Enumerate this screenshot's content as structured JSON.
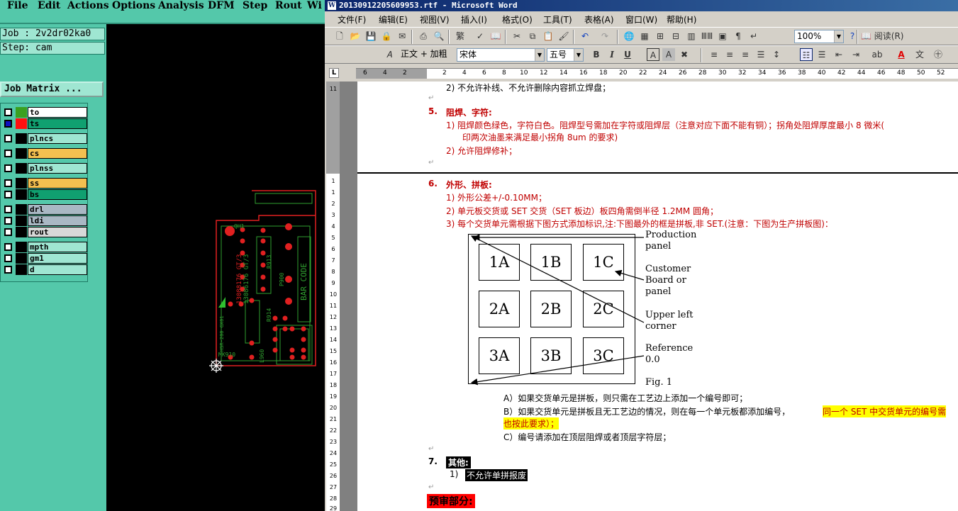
{
  "cam": {
    "menu": [
      "File",
      "Edit",
      "Actions",
      "Options",
      "Analysis",
      "DFM",
      "Step",
      "Rout",
      "Wi"
    ],
    "job_label": "Job : 2v2dr02ka0",
    "step_label": "Step: cam",
    "job_matrix_button": "Job Matrix ...",
    "layers": [
      {
        "name": "to",
        "color": "#ffffff",
        "swatch2": "#3aa020",
        "checked": false
      },
      {
        "name": "ts",
        "color": "#10a070",
        "swatch2": "#ff1010",
        "checked": true
      },
      {
        "name": "plncs",
        "color": "#9fe6d2",
        "checked": false
      },
      {
        "name": "cs",
        "color": "#f4c050",
        "checked": false
      },
      {
        "name": "plnss",
        "color": "#9fe6d2",
        "checked": false
      },
      {
        "name": "ss",
        "color": "#f4c050",
        "checked": false
      },
      {
        "name": "bs",
        "color": "#10a070",
        "checked": false
      },
      {
        "name": "drl",
        "color": "#a9b8c4",
        "checked": false
      },
      {
        "name": "ldi",
        "color": "#a9b8c4",
        "checked": false
      },
      {
        "name": "rout",
        "color": "#d8d8d8",
        "checked": false
      },
      {
        "name": "mpth",
        "color": "#9fe6d2",
        "checked": false
      },
      {
        "name": "gm1",
        "color": "#9fe6d2",
        "checked": false
      },
      {
        "name": "d",
        "color": "#9fe6d2",
        "checked": false
      }
    ],
    "board_text": {
      "refs": [
        "QH1",
        "R913",
        "R914",
        "MK910",
        "L960",
        "P900"
      ],
      "vertical": [
        "13088176 GT/3",
        "13086176 GT/3",
        "BAR CODE",
        "HSR-200 GX01"
      ]
    }
  },
  "word": {
    "title": "20130912205609953.rtf - Microsoft Word",
    "menu": [
      "文件(F)",
      "编辑(E)",
      "视图(V)",
      "插入(I)",
      "格式(O)",
      "工具(T)",
      "表格(A)",
      "窗口(W)",
      "帮助(H)"
    ],
    "zoom": "100%",
    "read_button": "阅读(R)",
    "style_combo": "正文 + 加粗",
    "font_combo": "宋体",
    "size_combo": "五号",
    "ruler_numbers": [
      "6",
      "4",
      "2",
      "2",
      "4",
      "6",
      "8",
      "10",
      "12",
      "14",
      "16",
      "18",
      "20",
      "22",
      "24",
      "26",
      "28",
      "30",
      "32",
      "34",
      "36",
      "38",
      "40",
      "42",
      "44",
      "46",
      "48",
      "50",
      "52"
    ],
    "vruler_numbers": [
      "11",
      "1",
      "1",
      "2",
      "3",
      "4",
      "5",
      "6",
      "7",
      "8",
      "9",
      "10",
      "11",
      "12",
      "13",
      "14",
      "15",
      "16",
      "17",
      "18",
      "19",
      "20",
      "21",
      "22",
      "23",
      "24",
      "25",
      "26",
      "27",
      "28",
      "29"
    ],
    "doc": {
      "top_item": "2)  不允许补线、不允许删除内容抓立焊盘；",
      "s5_num": "5.",
      "s5_title": "阻焊、字符:",
      "s5_item1a": "1)  阻焊颜色绿色，字符白色。阻焊型号需加在字符或阻焊层（注意对应下面不能有铜）；拐角处阻焊厚度最小 8 微米(",
      "s5_item1b": "印两次油墨来满足最小拐角 8um 的要求)",
      "s5_item2": "2)  允许阻焊修补；",
      "s6_num": "6.",
      "s6_title": "外形、拼板:",
      "s6_item1": "1)  外形公差+/-0.10MM；",
      "s6_item2": "2)  单元板交货或 SET 交货（SET 板边）板四角需倒半径 1.2MM 圆角；",
      "s6_item3": "3)  每个交货单元需根据下图方式添加标识,注:下图最外的框是拼板,非 SET.(注意：下图为生产拼板图)：",
      "fig": {
        "cells": [
          "1A",
          "1B",
          "1C",
          "2A",
          "2B",
          "2C",
          "3A",
          "3B",
          "3C"
        ],
        "label_production": "Production panel",
        "label_customer": "Customer Board or panel",
        "label_upper": "Upper left corner",
        "label_reference": "Reference 0.0",
        "caption": "Fig. 1"
      },
      "itemA": "A）如果交货单元是拼板，则只需在工艺边上添加一个编号即可；",
      "itemB_pre": "B）如果交货单元是拼板且无工艺边的情况，则在每一个单元板都添加编号，",
      "itemB_hl": "同一个 SET 中交货单元的编号需",
      "itemB_line2": "也按此要求）；",
      "itemC": "C）编号请添加在顶层阻焊或者顶层字符层；",
      "s7_num": "7.",
      "s7_title": "其他:",
      "s7_item1_num": "1)",
      "s7_item1": "不允许单拼报废",
      "pre_review": "预审部分:"
    }
  }
}
